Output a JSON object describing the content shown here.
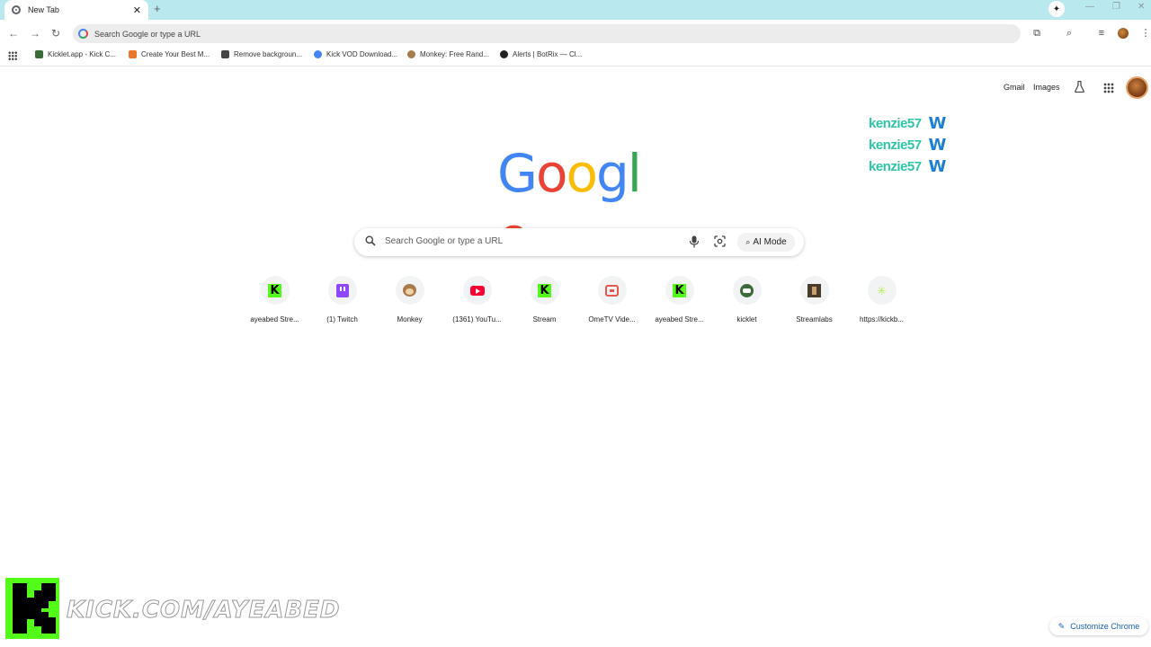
{
  "tab": {
    "title": "New Tab",
    "close": "✕",
    "new_tab": "+"
  },
  "window_controls": {
    "minimize": "—",
    "restore": "❐",
    "close": "✕"
  },
  "omnibox": {
    "placeholder": "Search Google or type a URL"
  },
  "bookmarks": [
    {
      "label": "Kicklet.app - Kick C...",
      "color": "#3b6b3b"
    },
    {
      "label": "Create Your Best M...",
      "color": "#e8762b"
    },
    {
      "label": "Remove backgroun...",
      "color": "#444444"
    },
    {
      "label": "Kick VOD Download...",
      "color": "#4285f4"
    },
    {
      "label": "Monkey: Free Rand...",
      "color": "#a87b4f"
    },
    {
      "label": "Alerts | BotRix — Cl...",
      "color": "#222222"
    }
  ],
  "ntp_links": {
    "gmail": "Gmail",
    "images": "Images"
  },
  "overlay_events": [
    {
      "name": "kenzie57",
      "badge": "W"
    },
    {
      "name": "kenzie57",
      "badge": "W"
    },
    {
      "name": "kenzie57",
      "badge": "W"
    }
  ],
  "logo": {
    "letters": [
      "G",
      "o",
      "o",
      "g",
      "l",
      "e"
    ],
    "colors": [
      "#4285f4",
      "#ea4335",
      "#fbbc05",
      "#4285f4",
      "#34a853",
      "#ea4335"
    ]
  },
  "search": {
    "placeholder": "Search Google or type a URL",
    "ai_mode": "AI Mode"
  },
  "shortcuts": [
    {
      "label": "ayeabed Stre...",
      "icon": "kick-icon"
    },
    {
      "label": "(1) Twitch",
      "icon": "twitch-icon"
    },
    {
      "label": "Monkey",
      "icon": "monkey-icon"
    },
    {
      "label": "(1361) YouTu...",
      "icon": "youtube-icon"
    },
    {
      "label": "Stream",
      "icon": "kick-icon"
    },
    {
      "label": "OmeTV Vide...",
      "icon": "ometv-icon"
    },
    {
      "label": "ayeabed Stre...",
      "icon": "kick-icon"
    },
    {
      "label": "kicklet",
      "icon": "kicklet-icon"
    },
    {
      "label": "Streamlabs",
      "icon": "streamlabs-icon"
    },
    {
      "label": "https://kickb...",
      "icon": "kickbot-icon"
    }
  ],
  "stream_overlay": {
    "url": "KICK.COM/AYEABED"
  },
  "customize": {
    "label": "Customize Chrome"
  },
  "colors": {
    "tabstrip": "#b9e8ee",
    "kick_green": "#53fc18",
    "event_name": "#2ec4a6",
    "event_badge": "#1e7fd8"
  }
}
